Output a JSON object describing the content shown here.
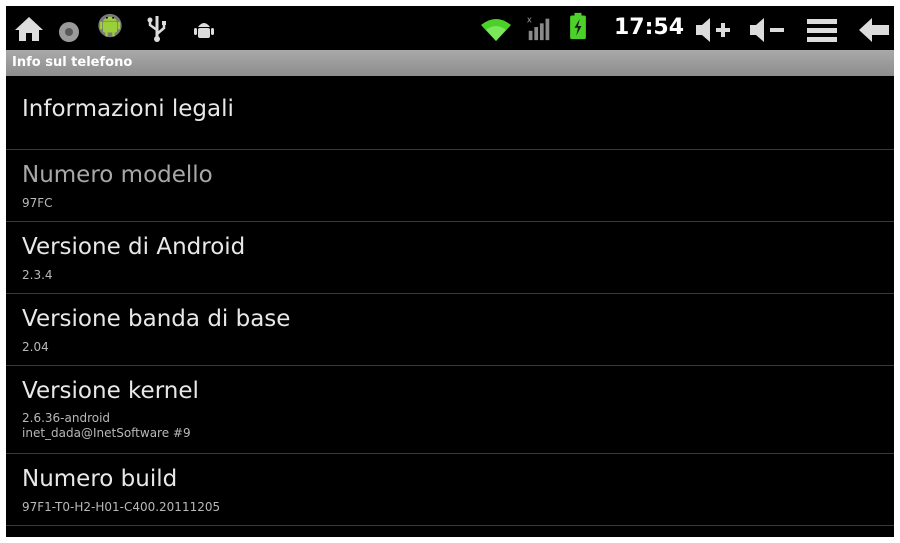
{
  "status_bar": {
    "left_icons": [
      "home-icon",
      "record-icon",
      "android-app-icon",
      "usb-icon",
      "debug-icon"
    ],
    "right_icons": [
      "wifi-icon",
      "signal-icon",
      "battery-charging-icon"
    ],
    "time": "17:54",
    "nav_icons": [
      "volume-up-icon",
      "volume-down-icon",
      "menu-icon",
      "back-icon"
    ]
  },
  "title": "Info sul telefono",
  "items": [
    {
      "title": "Informazioni legali",
      "sub": []
    },
    {
      "title": "Numero modello",
      "sub": [
        "97FC"
      ]
    },
    {
      "title": "Versione di Android",
      "sub": [
        "2.3.4"
      ]
    },
    {
      "title": "Versione banda di base",
      "sub": [
        "2.04"
      ]
    },
    {
      "title": "Versione kernel",
      "sub": [
        "2.6.36-android",
        "inet_dada@InetSoftware #9"
      ]
    },
    {
      "title": "Numero build",
      "sub": [
        "97F1-T0-H2-H01-C400.20111205"
      ]
    }
  ],
  "colors": {
    "background": "#000000",
    "title_bar": "#9a9a9a",
    "wifi": "#4cd02a",
    "battery": "#4cd02a"
  }
}
